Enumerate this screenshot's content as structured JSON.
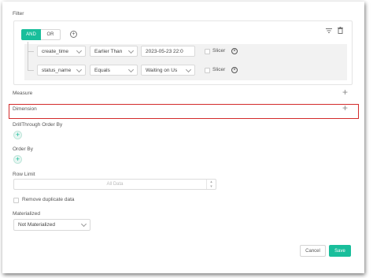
{
  "filter": {
    "title": "Filter",
    "and_label": "AND",
    "or_label": "OR",
    "rows": [
      {
        "field": "create_time",
        "operator": "Earlier Than",
        "value": "2023-05-23 22:0",
        "slicer": "Slicer"
      },
      {
        "field": "status_name",
        "operator": "Equals",
        "value": "Waiting on Us",
        "slicer": "Slicer"
      }
    ]
  },
  "measure": {
    "label": "Measure"
  },
  "dimension": {
    "label": "Dimension"
  },
  "drillthrough": {
    "label": "DrillThrough Order By"
  },
  "orderby": {
    "label": "Order By"
  },
  "rowlimit": {
    "label": "Row Limit",
    "placeholder": "All Data"
  },
  "remove_duplicate": {
    "label": "Remove duplicate data"
  },
  "materialized": {
    "label": "Materialized",
    "value": "Not Materialized"
  },
  "footer": {
    "cancel": "Cancel",
    "save": "Save"
  },
  "colors": {
    "accent": "#19be9b",
    "highlight": "#d32b2b"
  },
  "icons": [
    "add-circle-icon",
    "filter-settings-icon",
    "trash-icon",
    "chevron-down-icon",
    "clear-circle-icon",
    "plus-icon",
    "stepper-icon"
  ]
}
